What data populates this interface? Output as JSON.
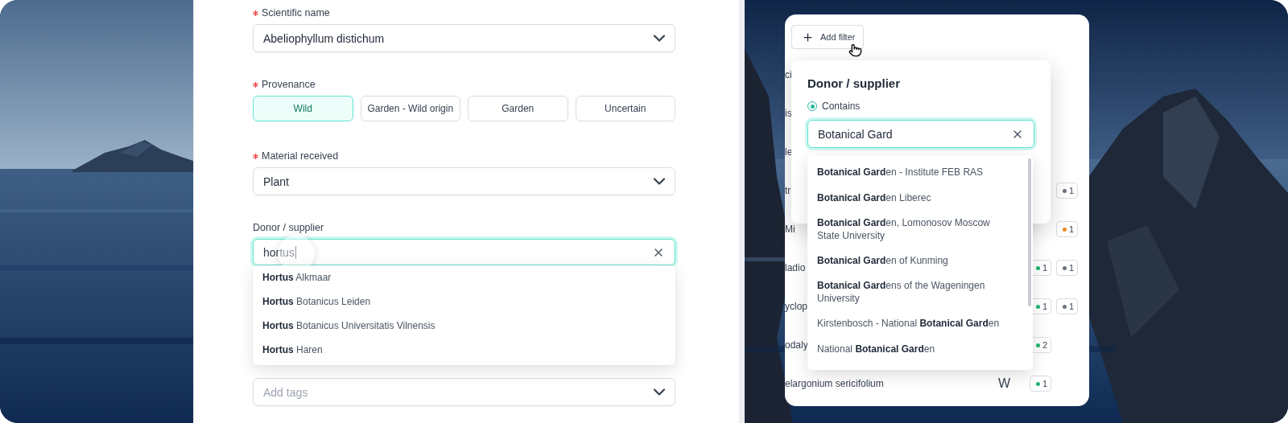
{
  "form": {
    "fields": [
      {
        "kind": "select",
        "label": "Scientific name",
        "required": true,
        "value": "Abeliophyllum distichum"
      },
      {
        "kind": "choices",
        "label": "Provenance",
        "required": true,
        "options": [
          {
            "label": "Wild",
            "selected": true
          },
          {
            "label": "Garden - Wild origin",
            "selected": false
          },
          {
            "label": "Garden",
            "selected": false
          },
          {
            "label": "Uncertain",
            "selected": false
          }
        ]
      },
      {
        "kind": "select",
        "label": "Material received",
        "required": true,
        "value": "Plant"
      },
      {
        "kind": "search",
        "label": "Donor / supplier",
        "required": false,
        "value": "hortus",
        "focused": true,
        "suggestions": [
          "**Hortus** Alkmaar",
          "**Hortus** Botanicus Leiden",
          "**Hortus** Botanicus Universitatis Vilnensis",
          "**Hortus** Haren"
        ]
      },
      {
        "kind": "select",
        "placeholder": "Add tags"
      }
    ]
  },
  "filter_panel": {
    "add_filter_button": "Add filter",
    "rows": [
      {
        "column_1": "ci"
      },
      {
        "column_1": "is"
      },
      {
        "column_1": "le"
      },
      {
        "column_1": "tr",
        "column_4": {
          "count": "1",
          "color": "#6b7280"
        }
      },
      {
        "column_1": "Mi",
        "column_4": {
          "count": "1",
          "color": "#f08a24"
        }
      },
      {
        "column_1": "ladio",
        "column_3": {
          "count": "1",
          "color": "#22b573"
        },
        "column_4": {
          "count": "1",
          "color": "#6b7280"
        }
      },
      {
        "column_1": "yclop",
        "column_3": {
          "count": "1",
          "color": "#22b573"
        },
        "column_4": {
          "count": "1",
          "color": "#6b7280"
        }
      },
      {
        "column_1": "odaly",
        "column_3": {
          "count": "2",
          "color": "#22b573"
        }
      },
      {
        "column_1": "elargonium sericifolium",
        "column_2": "W",
        "column_3": {
          "count": "1",
          "color": "#22b573"
        }
      }
    ],
    "popover": {
      "title": "Donor / supplier",
      "option": {
        "label": "Contains",
        "selected": true
      },
      "search": {
        "value": "Botanical Gard",
        "focused": true
      },
      "suggestions": [
        "**Botanical Gard**en - Institute FEB RAS",
        "**Botanical Gard**en Liberec",
        "**Botanical Gard**en, Lomonosov Moscow State University",
        "**Botanical Gard**en of Kunming",
        "**Botanical Gard**ens of the Wageningen University",
        "Kirstenbosch - National **Botanical Gard**en",
        "National **Botanical Gard**en"
      ]
    }
  }
}
